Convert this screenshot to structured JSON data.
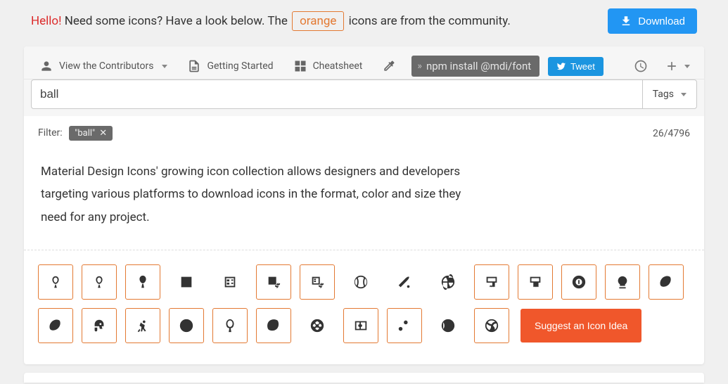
{
  "banner": {
    "hello": "Hello!",
    "text1": " Need some icons? Have a look below. The ",
    "orange": "orange",
    "text2": " icons are from the community."
  },
  "download_label": "Download",
  "toolbar": {
    "contributors": "View the Contributors",
    "getting_started": "Getting Started",
    "cheatsheet": "Cheatsheet",
    "npm": "npm install @mdi/font",
    "tweet": "Tweet"
  },
  "search": {
    "value": "ball",
    "tags_label": "Tags"
  },
  "filter": {
    "label": "Filter:",
    "chip": "\"ball\"",
    "count": "26/4796"
  },
  "intro": "Material Design Icons' growing icon collection allows designers and developers targeting various platforms to download icons in the format, color and size they need for any project.",
  "suggest_label": "Suggest an Icon Idea",
  "icon_items": [
    {
      "name": "balloon-outline",
      "selected": true
    },
    {
      "name": "balloon-outline-2",
      "selected": true
    },
    {
      "name": "balloon",
      "selected": true
    },
    {
      "name": "ballot"
    },
    {
      "name": "ballot-outline"
    },
    {
      "name": "ballot-recount",
      "selected": true
    },
    {
      "name": "ballot-recount-outline",
      "selected": true
    },
    {
      "name": "baseball"
    },
    {
      "name": "baseball-bat"
    },
    {
      "name": "basketball"
    },
    {
      "name": "basketball-hoop",
      "selected": true
    },
    {
      "name": "basketball-hoop-outline",
      "selected": true
    },
    {
      "name": "billiards",
      "selected": true
    },
    {
      "name": "crystal-ball",
      "selected": true
    },
    {
      "name": "football",
      "selected": true
    },
    {
      "name": "football-australian",
      "selected": true
    },
    {
      "name": "football-helmet",
      "selected": true
    },
    {
      "name": "handball",
      "selected": true
    },
    {
      "name": "pokeball",
      "selected": true
    },
    {
      "name": "racquetball",
      "selected": true
    },
    {
      "name": "rugby",
      "selected": true
    },
    {
      "name": "soccer"
    },
    {
      "name": "soccer-field",
      "selected": true
    },
    {
      "name": "strategy",
      "selected": true
    },
    {
      "name": "tennis-ball"
    },
    {
      "name": "volleyball",
      "selected": true
    }
  ],
  "chart_data": null
}
